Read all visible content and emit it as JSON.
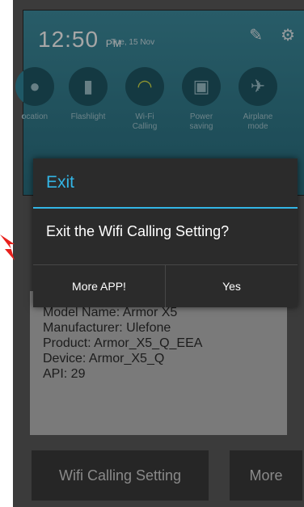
{
  "shade": {
    "time": "12:50",
    "ampm": "PM",
    "date": "Tue, 15 Nov",
    "tiles": [
      {
        "label": "ocation",
        "icon": "location-icon"
      },
      {
        "label": "Flashlight",
        "icon": "flashlight-icon"
      },
      {
        "label": "Wi-Fi Calling",
        "icon": "wifi-calling-icon"
      },
      {
        "label": "Power saving",
        "icon": "power-saving-icon"
      },
      {
        "label": "Airplane mode",
        "icon": "airplane-icon"
      }
    ]
  },
  "dialog": {
    "title": "Exit",
    "message": "Exit the Wifi Calling Setting?",
    "negative_label": "More APP!",
    "positive_label": "Yes"
  },
  "device_info": {
    "model": "Model Name: Armor X5",
    "manufacturer": "Manufacturer: Ulefone",
    "product": "Product: Armor_X5_Q_EEA",
    "device": "Device: Armor_X5_Q",
    "api": "API: 29"
  },
  "buttons": {
    "settings_label": "Wifi Calling Setting",
    "more_label": "More"
  },
  "colors": {
    "accent": "#33b5e5",
    "arrow": "#e8201c"
  }
}
